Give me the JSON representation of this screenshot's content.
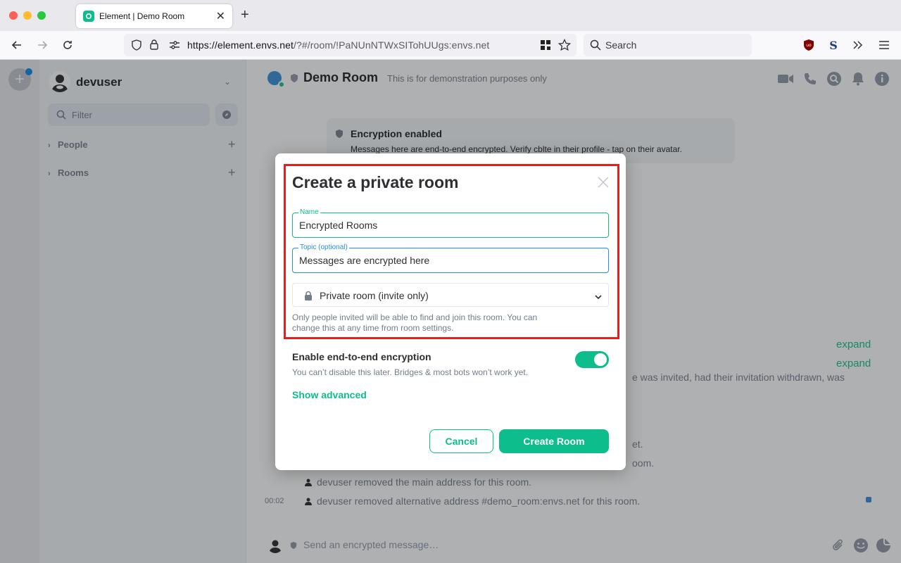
{
  "browser": {
    "tab_title": "Element | Demo Room",
    "url_host": "https://element.envs.net",
    "url_path": "/?#/room/!PaNUnNTWxSITohUUgs:envs.net",
    "search_placeholder": "Search"
  },
  "sidebar": {
    "username": "devuser",
    "filter_placeholder": "Filter",
    "sections": [
      {
        "label": "People"
      },
      {
        "label": "Rooms"
      }
    ]
  },
  "room": {
    "name": "Demo Room",
    "topic": "This is for demonstration purposes only",
    "encryption_banner": {
      "title": "Encryption enabled",
      "description": "Messages here are end-to-end encrypted. Verify cblte in their profile - tap on their avatar."
    },
    "expand_label": "expand",
    "timeline": {
      "partial_1": "e was invited, had their invitation withdrawn, was",
      "partial_2": "et.",
      "partial_3": "oom.",
      "line_1": "devuser removed the main address for this room.",
      "line_2": "devuser removed alternative address #demo_room:envs.net for this room.",
      "timestamp": "00:02"
    },
    "composer_placeholder": "Send an encrypted message…"
  },
  "dialog": {
    "title": "Create a private room",
    "name_label": "Name",
    "name_value": "Encrypted Rooms",
    "topic_label": "Topic (optional)",
    "topic_value": "Messages are encrypted here",
    "join_rule": "Private room (invite only)",
    "join_rule_desc": "Only people invited will be able to find and join this room. You can change this at any time from room settings.",
    "e2e_title": "Enable end-to-end encryption",
    "e2e_desc": "You can’t disable this later. Bridges & most bots won’t work yet.",
    "e2e_enabled": true,
    "show_advanced": "Show advanced",
    "cancel": "Cancel",
    "create": "Create Room"
  },
  "colors": {
    "accent": "#0dbd8b",
    "focus_blue": "#238cf5",
    "highlight_red": "#ee1b1b"
  }
}
